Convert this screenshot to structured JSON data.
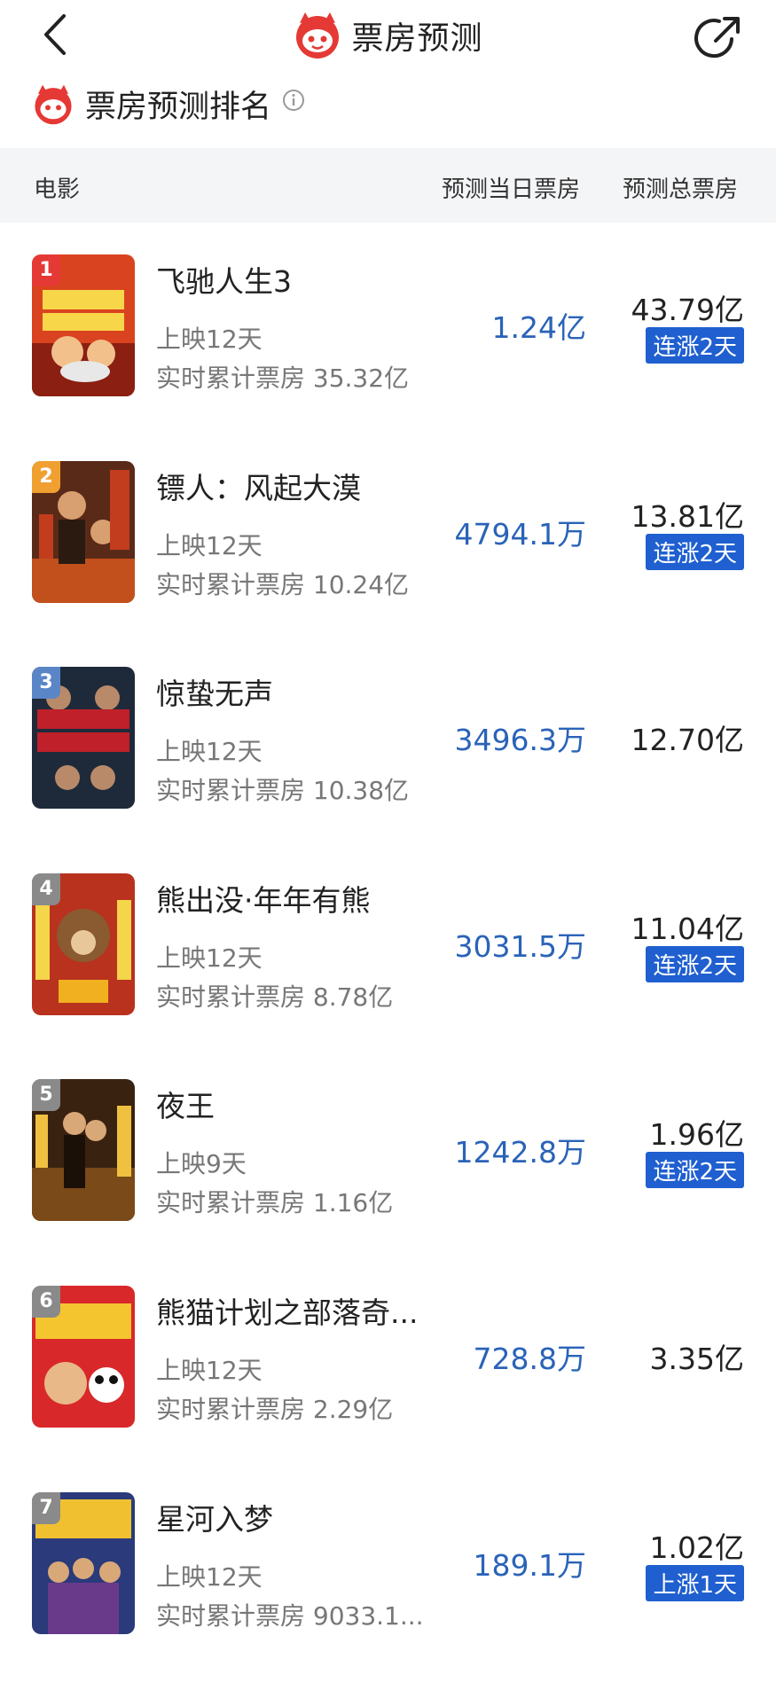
{
  "header": {
    "title": "票房预测"
  },
  "section": {
    "title": "票房预测排名"
  },
  "table_head": {
    "movie": "电影",
    "day": "预测当日票房",
    "total": "预测总票房"
  },
  "colors": {
    "accent_blue": "#1f5fd0",
    "value_blue": "#2a63b8",
    "brand_red": "#e53935",
    "header_bg": "#f4f5f7"
  },
  "movies": [
    {
      "rank": "1",
      "name": "飞驰人生3",
      "days": "上映12天",
      "cumulative": "实时累计票房 35.32亿",
      "day_forecast": "1.24亿",
      "total_forecast": "43.79亿",
      "badge": "连涨2天"
    },
    {
      "rank": "2",
      "name": "镖人：风起大漠",
      "days": "上映12天",
      "cumulative": "实时累计票房 10.24亿",
      "day_forecast": "4794.1万",
      "total_forecast": "13.81亿",
      "badge": "连涨2天"
    },
    {
      "rank": "3",
      "name": "惊蛰无声",
      "days": "上映12天",
      "cumulative": "实时累计票房 10.38亿",
      "day_forecast": "3496.3万",
      "total_forecast": "12.70亿",
      "badge": ""
    },
    {
      "rank": "4",
      "name": "熊出没·年年有熊",
      "days": "上映12天",
      "cumulative": "实时累计票房 8.78亿",
      "day_forecast": "3031.5万",
      "total_forecast": "11.04亿",
      "badge": "连涨2天"
    },
    {
      "rank": "5",
      "name": "夜王",
      "days": "上映9天",
      "cumulative": "实时累计票房 1.16亿",
      "day_forecast": "1242.8万",
      "total_forecast": "1.96亿",
      "badge": "连涨2天"
    },
    {
      "rank": "6",
      "name": "熊猫计划之部落奇...",
      "days": "上映12天",
      "cumulative": "实时累计票房 2.29亿",
      "day_forecast": "728.8万",
      "total_forecast": "3.35亿",
      "badge": ""
    },
    {
      "rank": "7",
      "name": "星河入梦",
      "days": "上映12天",
      "cumulative": "实时累计票房 9033.1...",
      "day_forecast": "189.1万",
      "total_forecast": "1.02亿",
      "badge": "上涨1天"
    }
  ]
}
